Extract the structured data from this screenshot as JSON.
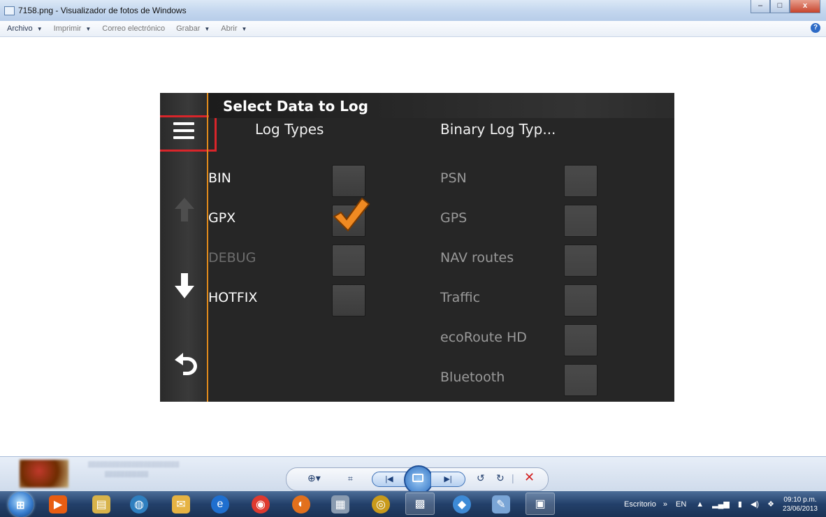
{
  "window": {
    "title": "7158.png - Visualizador de fotos de Windows",
    "buttons": {
      "minimize": "–",
      "maximize": "□",
      "close": "x"
    }
  },
  "menubar": {
    "items": [
      {
        "label": "Archivo",
        "has_dropdown": true
      },
      {
        "label": "Imprimir",
        "has_dropdown": true
      },
      {
        "label": "Correo electrónico",
        "has_dropdown": false
      },
      {
        "label": "Grabar",
        "has_dropdown": true
      },
      {
        "label": "Abrir",
        "has_dropdown": true
      }
    ],
    "help_glyph": "?"
  },
  "device": {
    "title": "Select Data to Log",
    "col_left_header": "Log Types",
    "col_right_header": "Binary Log Typ...",
    "left_rows": [
      {
        "label": "BIN",
        "checked": false,
        "enabled": true
      },
      {
        "label": "GPX",
        "checked": true,
        "enabled": true
      },
      {
        "label": "DEBUG",
        "checked": false,
        "enabled": false
      },
      {
        "label": "HOTFIX",
        "checked": false,
        "enabled": true
      }
    ],
    "right_rows": [
      {
        "label": "PSN",
        "checked": false,
        "enabled": false
      },
      {
        "label": "GPS",
        "checked": false,
        "enabled": false
      },
      {
        "label": "NAV routes",
        "checked": false,
        "enabled": false
      },
      {
        "label": "Traffic",
        "checked": false,
        "enabled": false
      },
      {
        "label": "ecoRoute HD",
        "checked": false,
        "enabled": false
      },
      {
        "label": "Bluetooth",
        "checked": false,
        "enabled": false
      }
    ],
    "sidebar_icons": [
      "menu-icon",
      "arrow-up-icon",
      "arrow-down-icon",
      "back-icon"
    ],
    "accent_color": "#e08a1c",
    "highlight_color": "#d9252a"
  },
  "playback": {
    "zoom_glyph": "⊕▾",
    "fit_glyph": "⌗",
    "prev_glyph": "|◀",
    "next_glyph": "▶|",
    "rotate_ccw_glyph": "↺",
    "rotate_cw_glyph": "↻",
    "delete_glyph": "✕"
  },
  "taskbar": {
    "desktop_label": "Escritorio",
    "chevron": "»",
    "language": "EN",
    "time": "09:10 p.m.",
    "date": "23/06/2013"
  }
}
